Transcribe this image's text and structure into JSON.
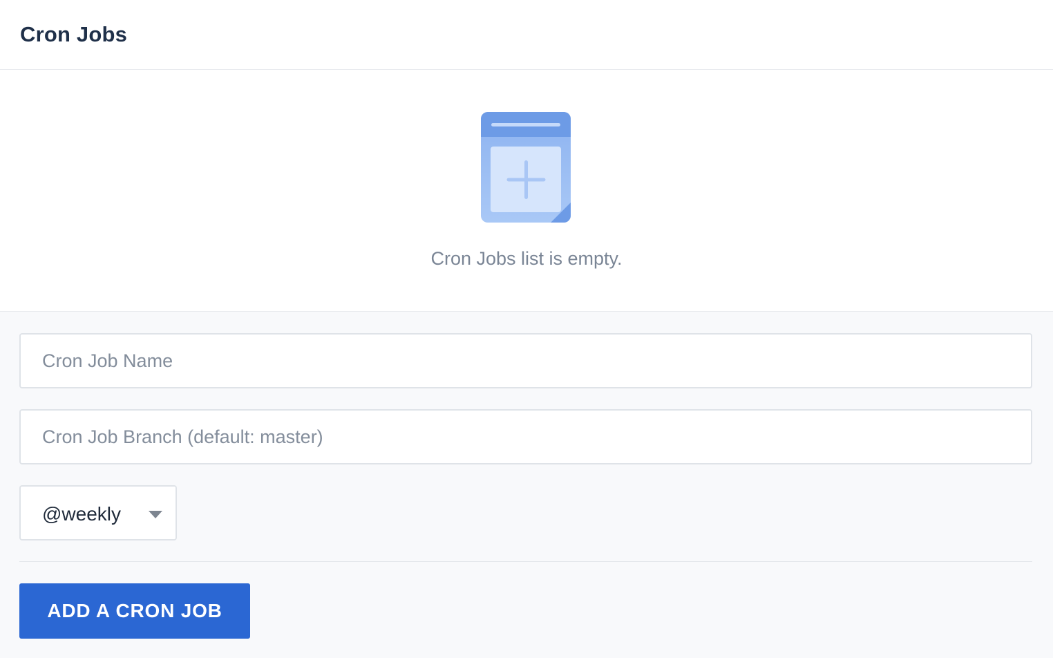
{
  "header": {
    "title": "Cron Jobs"
  },
  "empty_state": {
    "icon": "add-document-icon",
    "message": "Cron Jobs list is empty."
  },
  "form": {
    "name_field": {
      "value": "",
      "placeholder": "Cron Job Name"
    },
    "branch_field": {
      "value": "",
      "placeholder": "Cron Job Branch (default: master)"
    },
    "schedule_select": {
      "selected": "@weekly"
    },
    "submit_label": "ADD A CRON JOB"
  },
  "colors": {
    "primary_button": "#2b67d3",
    "title": "#1f3049",
    "muted_text": "#7a8595",
    "form_background": "#f8f9fb",
    "icon_blue": "#6d9be6"
  }
}
